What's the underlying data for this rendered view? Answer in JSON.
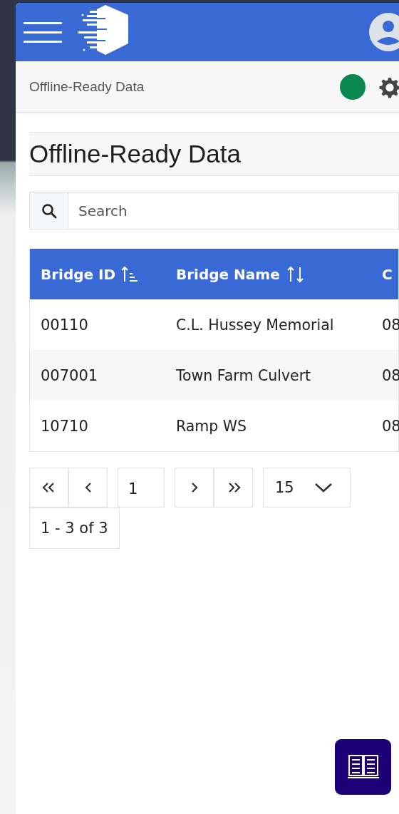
{
  "breadcrumb": {
    "label": "Offline-Ready Data",
    "status": {
      "color": "#0b8750"
    }
  },
  "page_title": "Offline-Ready Data",
  "search": {
    "placeholder": "Search"
  },
  "table": {
    "columns": [
      {
        "label": "Bridge ID",
        "sorted": true
      },
      {
        "label": "Bridge Name",
        "sorted": false
      },
      {
        "label": "C"
      }
    ],
    "rows": [
      {
        "cells": [
          "00110",
          "C.L. Hussey Memorial",
          "08"
        ]
      },
      {
        "cells": [
          "007001",
          "Town Farm Culvert",
          "08"
        ]
      },
      {
        "cells": [
          "10710",
          "Ramp WS",
          "08"
        ]
      }
    ]
  },
  "pagination": {
    "page": "1",
    "page_size": "15",
    "range": "1 - 3 of 3"
  }
}
